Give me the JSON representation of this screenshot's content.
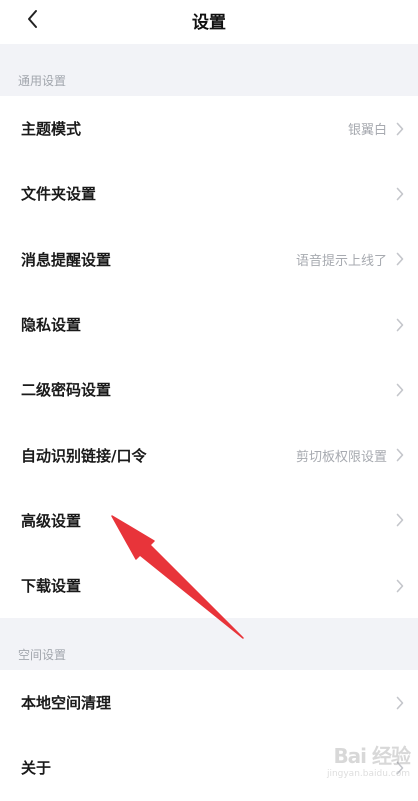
{
  "header": {
    "title": "设置",
    "back_icon": "chevron-left-icon"
  },
  "sections": {
    "general": {
      "label": "通用设置",
      "items": [
        {
          "label": "主题模式",
          "value": "银翼白"
        },
        {
          "label": "文件夹设置",
          "value": ""
        },
        {
          "label": "消息提醒设置",
          "value": "语音提示上线了"
        },
        {
          "label": "隐私设置",
          "value": ""
        },
        {
          "label": "二级密码设置",
          "value": ""
        },
        {
          "label": "自动识别链接/口令",
          "value": "剪切板权限设置"
        },
        {
          "label": "高级设置",
          "value": ""
        },
        {
          "label": "下载设置",
          "value": ""
        }
      ]
    },
    "space": {
      "label": "空间设置",
      "items": [
        {
          "label": "本地空间清理",
          "value": ""
        },
        {
          "label": "关于",
          "value": ""
        }
      ]
    }
  },
  "watermark": {
    "main": "Bai 经验",
    "sub": "jingyan.baidu.com"
  },
  "colors": {
    "background": "#f2f3f7",
    "card": "#ffffff",
    "muted_text": "#a7aab0",
    "annotation_arrow": "#e8343a"
  }
}
